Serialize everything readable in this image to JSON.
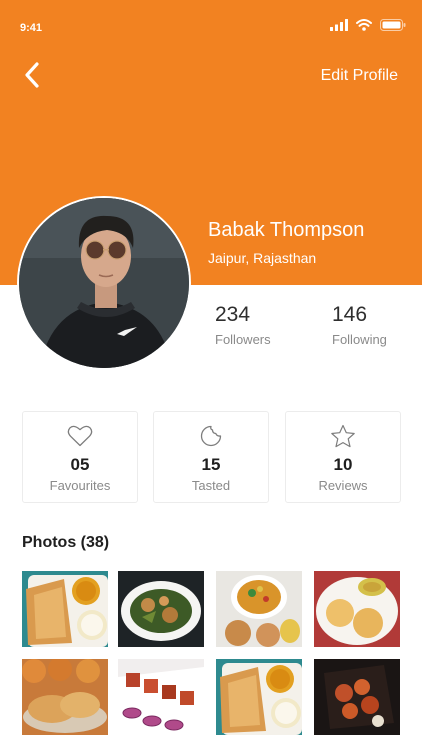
{
  "status_bar": {
    "time": "9:41",
    "icons": [
      "signal-icon",
      "wifi-icon",
      "battery-icon"
    ]
  },
  "header": {
    "back_icon": "chevron-left-icon",
    "edit_label": "Edit Profile",
    "background": "#f28221"
  },
  "profile": {
    "name": "Babak Thompson",
    "location": "Jaipur, Rajasthan"
  },
  "stats": {
    "followers": {
      "value": "234",
      "label": "Followers"
    },
    "following": {
      "value": "146",
      "label": "Following"
    }
  },
  "cards": [
    {
      "icon": "heart-icon",
      "count": "05",
      "label": "Favourites"
    },
    {
      "icon": "bitten-cookie-icon",
      "count": "15",
      "label": "Tasted"
    },
    {
      "icon": "star-icon",
      "count": "10",
      "label": "Reviews"
    }
  ],
  "photos": {
    "title": "Photos (38)"
  }
}
